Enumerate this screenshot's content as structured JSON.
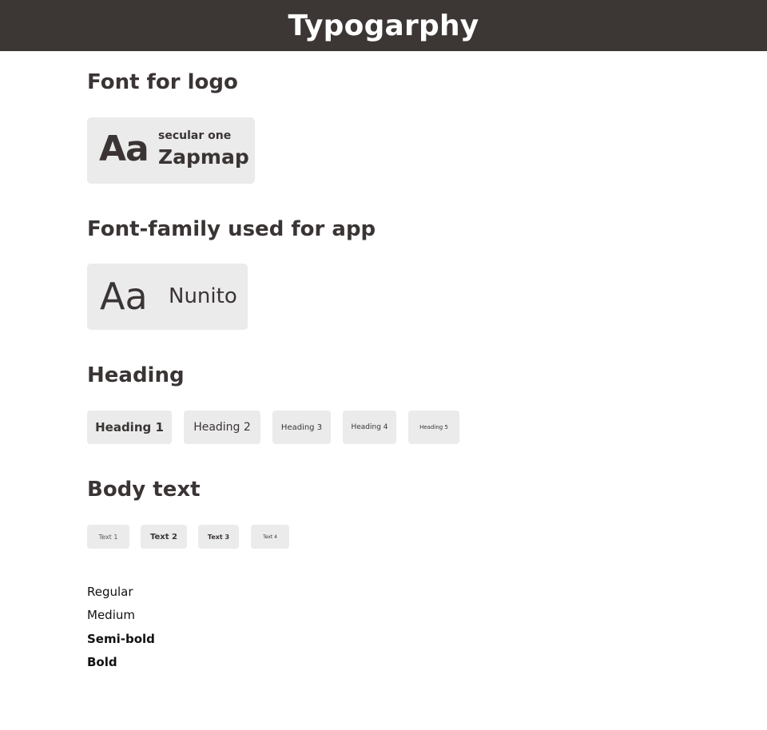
{
  "header": {
    "title": "Typogarphy"
  },
  "logo_section": {
    "title": "Font for logo",
    "sample": "Aa",
    "font_name": "secular one",
    "brand": "Zapmap"
  },
  "app_font_section": {
    "title": "Font-family used for app",
    "sample": "Aa",
    "font_name": "Nunito"
  },
  "heading_section": {
    "title": "Heading",
    "items": [
      "Heading 1",
      "Heading 2",
      "Heading 3",
      "Heading 4",
      "Heading 5"
    ]
  },
  "body_section": {
    "title": "Body text",
    "items": [
      "Text 1",
      "Text 2",
      "Text 3",
      "Text 4"
    ]
  },
  "weights": [
    "Regular",
    "Medium",
    "Semi-bold",
    "Bold"
  ],
  "colors": {
    "header_bg": "#3c3735",
    "card_bg": "#ebebeb",
    "text": "#3a3534"
  }
}
